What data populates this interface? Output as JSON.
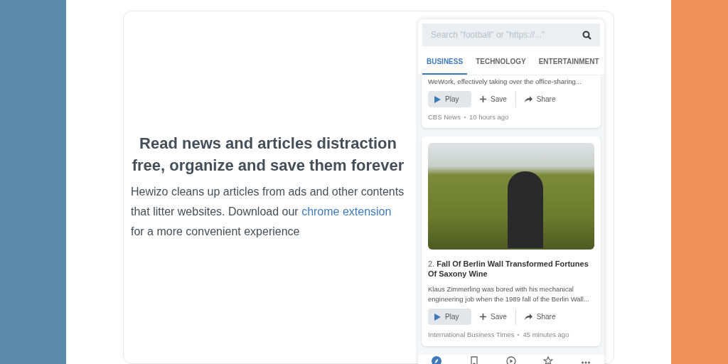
{
  "hero": {
    "heading": "Read news and articles distraction free, organize and save them forever",
    "text_before": "Hewizo cleans up articles from ads and other contents that litter websites. Download our",
    "link": "chrome extension",
    "text_after": "for a more convenient experience"
  },
  "app": {
    "search": {
      "placeholder": "Search \"football\" or \"https://...\""
    },
    "tabs": [
      {
        "label": "BUSINESS",
        "selected": true
      },
      {
        "label": "TECHNOLOGY",
        "selected": false
      },
      {
        "label": "ENTERTAINMENT",
        "selected": false
      }
    ],
    "articles": [
      {
        "kind": "text",
        "excerpt": "WeWork, effectively taking over the office-sharing...",
        "actions": [
          {
            "kind": "play",
            "label": "Play"
          },
          {
            "kind": "save",
            "label": "Save"
          },
          {
            "kind": "share",
            "label": "Share"
          }
        ],
        "source": "CBS News",
        "time": "10 hours ago"
      },
      {
        "kind": "photo",
        "number": "2.",
        "title": "Fall Of Berlin Wall Transformed Fortunes Of Saxony Wine",
        "excerpt": "Klaus Zimmerling was bored with his mechanical engineering job when the 1989 fall of the Berlin Wall...",
        "actions": [
          {
            "kind": "play",
            "label": "Play"
          },
          {
            "kind": "save",
            "label": "Save"
          },
          {
            "kind": "share",
            "label": "Share"
          }
        ],
        "source": "International Business Times",
        "time": "45 minutes ago"
      }
    ],
    "nav": [
      {
        "kind": "compass",
        "selected": true
      },
      {
        "kind": "bookmark",
        "selected": false
      },
      {
        "kind": "play",
        "selected": false
      },
      {
        "kind": "star",
        "selected": false
      },
      {
        "kind": "more",
        "selected": false
      }
    ]
  }
}
